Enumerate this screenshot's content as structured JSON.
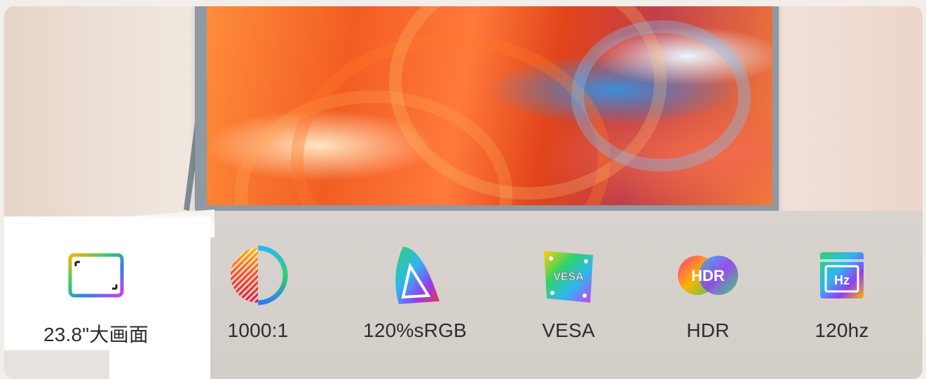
{
  "features": [
    {
      "label": "23.8\"大画面",
      "icon": "display-frame-icon"
    },
    {
      "label": "1000:1",
      "icon": "contrast-icon"
    },
    {
      "label": "120%sRGB",
      "icon": "color-gamut-icon"
    },
    {
      "label": "VESA",
      "icon": "vesa-plate-icon",
      "icon_text": "VESA"
    },
    {
      "label": "HDR",
      "icon": "hdr-icon",
      "icon_text": "HDR"
    },
    {
      "label": "120hz",
      "icon": "refresh-rate-icon",
      "icon_text": "Hz"
    }
  ],
  "colors": {
    "ledge": "#d6d1cb",
    "text": "#2d2d2d",
    "screen_accent": "#f25d22"
  }
}
